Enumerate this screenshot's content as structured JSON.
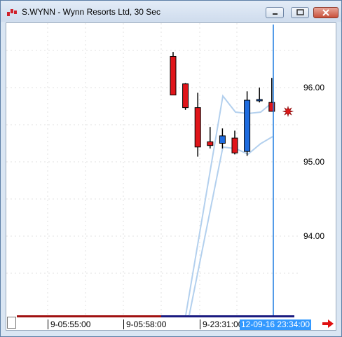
{
  "window": {
    "title": "S.WYNN - Wynn Resorts Ltd, 30 Sec",
    "controls": [
      "minimize-icon",
      "restore-icon",
      "close-icon"
    ]
  },
  "chart_data": {
    "type": "candlestick",
    "symbol": "S.WYNN",
    "title": "Wynn Resorts Ltd, 30 Sec",
    "y_ticks": [
      "96.00",
      "95.00",
      "94.00"
    ],
    "ylim": [
      93.1,
      96.8
    ],
    "x_labels": [
      "9-05:55:00",
      "9-05:58:00",
      "9-23:31:00"
    ],
    "cursor_time": "12-09-16 23:34:00",
    "colors": {
      "up": "#1e6ce0",
      "down": "#e0151a",
      "band": "#b3d0ee",
      "cursor": "#1a7ae0"
    },
    "candles": [
      {
        "open": 95.9,
        "high": 96.48,
        "low": 96.0,
        "close": 96.42,
        "dir": "down"
      },
      {
        "open": 96.05,
        "high": 96.06,
        "low": 95.7,
        "close": 95.73,
        "dir": "down"
      },
      {
        "open": 95.73,
        "high": 95.93,
        "low": 95.07,
        "close": 95.2,
        "dir": "down"
      },
      {
        "open": 95.27,
        "high": 95.47,
        "low": 95.18,
        "close": 95.22,
        "dir": "down"
      },
      {
        "open": 95.25,
        "high": 95.45,
        "low": 95.18,
        "close": 95.35,
        "dir": "up"
      },
      {
        "open": 95.32,
        "high": 95.42,
        "low": 95.1,
        "close": 95.12,
        "dir": "down"
      },
      {
        "open": 95.14,
        "high": 95.95,
        "low": 95.08,
        "close": 95.83,
        "dir": "up"
      },
      {
        "open": 95.84,
        "high": 96.0,
        "low": 95.8,
        "close": 95.84,
        "dir": "up"
      },
      {
        "open": 95.8,
        "high": 96.13,
        "low": 95.68,
        "close": 95.68,
        "dir": "down"
      }
    ],
    "band_upper": [
      null,
      null,
      null,
      null,
      93.1,
      95.88,
      95.68,
      95.65,
      95.77
    ],
    "band_lower": [
      null,
      null,
      null,
      null,
      93.1,
      95.25,
      95.12,
      95.3,
      95.38
    ],
    "last_marker": "red-star-icon"
  },
  "axis": {
    "price_labels": [
      "96.00",
      "95.00",
      "94.00"
    ],
    "time_labels": [
      "9-05:55:00",
      "9-05:58:00",
      "9-23:31:00"
    ],
    "cursor_label": "12-09-16 23:34:00"
  },
  "scroll_arrow": "arrow-right-icon"
}
